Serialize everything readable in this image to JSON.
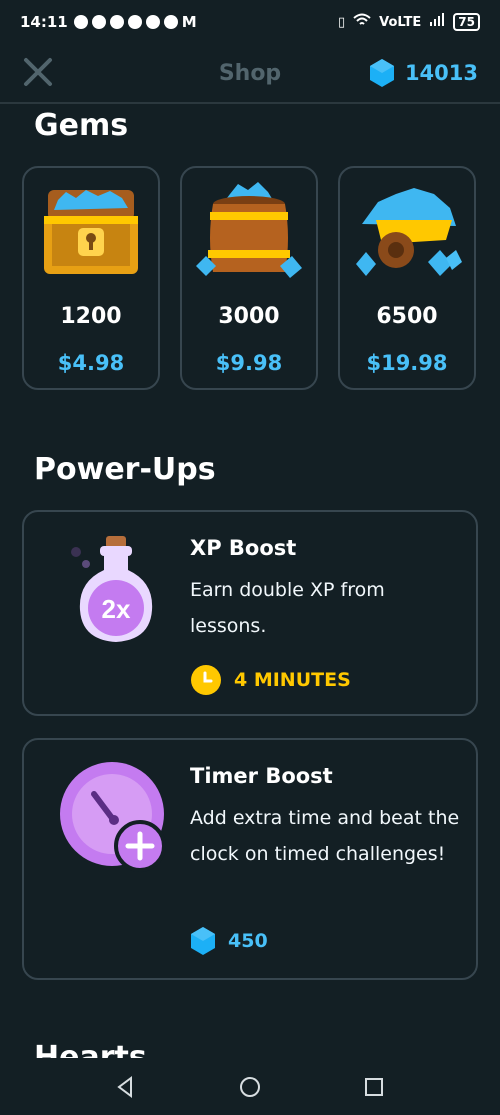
{
  "status_bar": {
    "time": "14:11",
    "network": "VoLTE",
    "battery": "75"
  },
  "header": {
    "title": "Shop",
    "gem_count": "14013"
  },
  "gems": {
    "title": "Gems",
    "items": [
      {
        "amount": "1200",
        "price": "$4.98",
        "icon": "chest-icon"
      },
      {
        "amount": "3000",
        "price": "$9.98",
        "icon": "barrel-icon"
      },
      {
        "amount": "6500",
        "price": "$19.98",
        "icon": "cart-icon"
      }
    ]
  },
  "powerups": {
    "title": "Power-Ups",
    "items": [
      {
        "title": "XP Boost",
        "desc": "Earn double XP from lessons.",
        "meta": "4 MINUTES",
        "icon": "xp-potion-icon",
        "meta_icon": "clock-icon"
      },
      {
        "title": "Timer Boost",
        "desc": "Add extra time and beat the clock on timed challenges!",
        "meta": "450",
        "icon": "timer-icon",
        "meta_icon": "gem-icon"
      }
    ]
  },
  "hearts": {
    "title": "Hearts"
  },
  "colors": {
    "background": "#131f24",
    "border": "#37464f",
    "accent_blue": "#49c0f8",
    "accent_gold": "#ffc800",
    "muted": "#52656d"
  }
}
